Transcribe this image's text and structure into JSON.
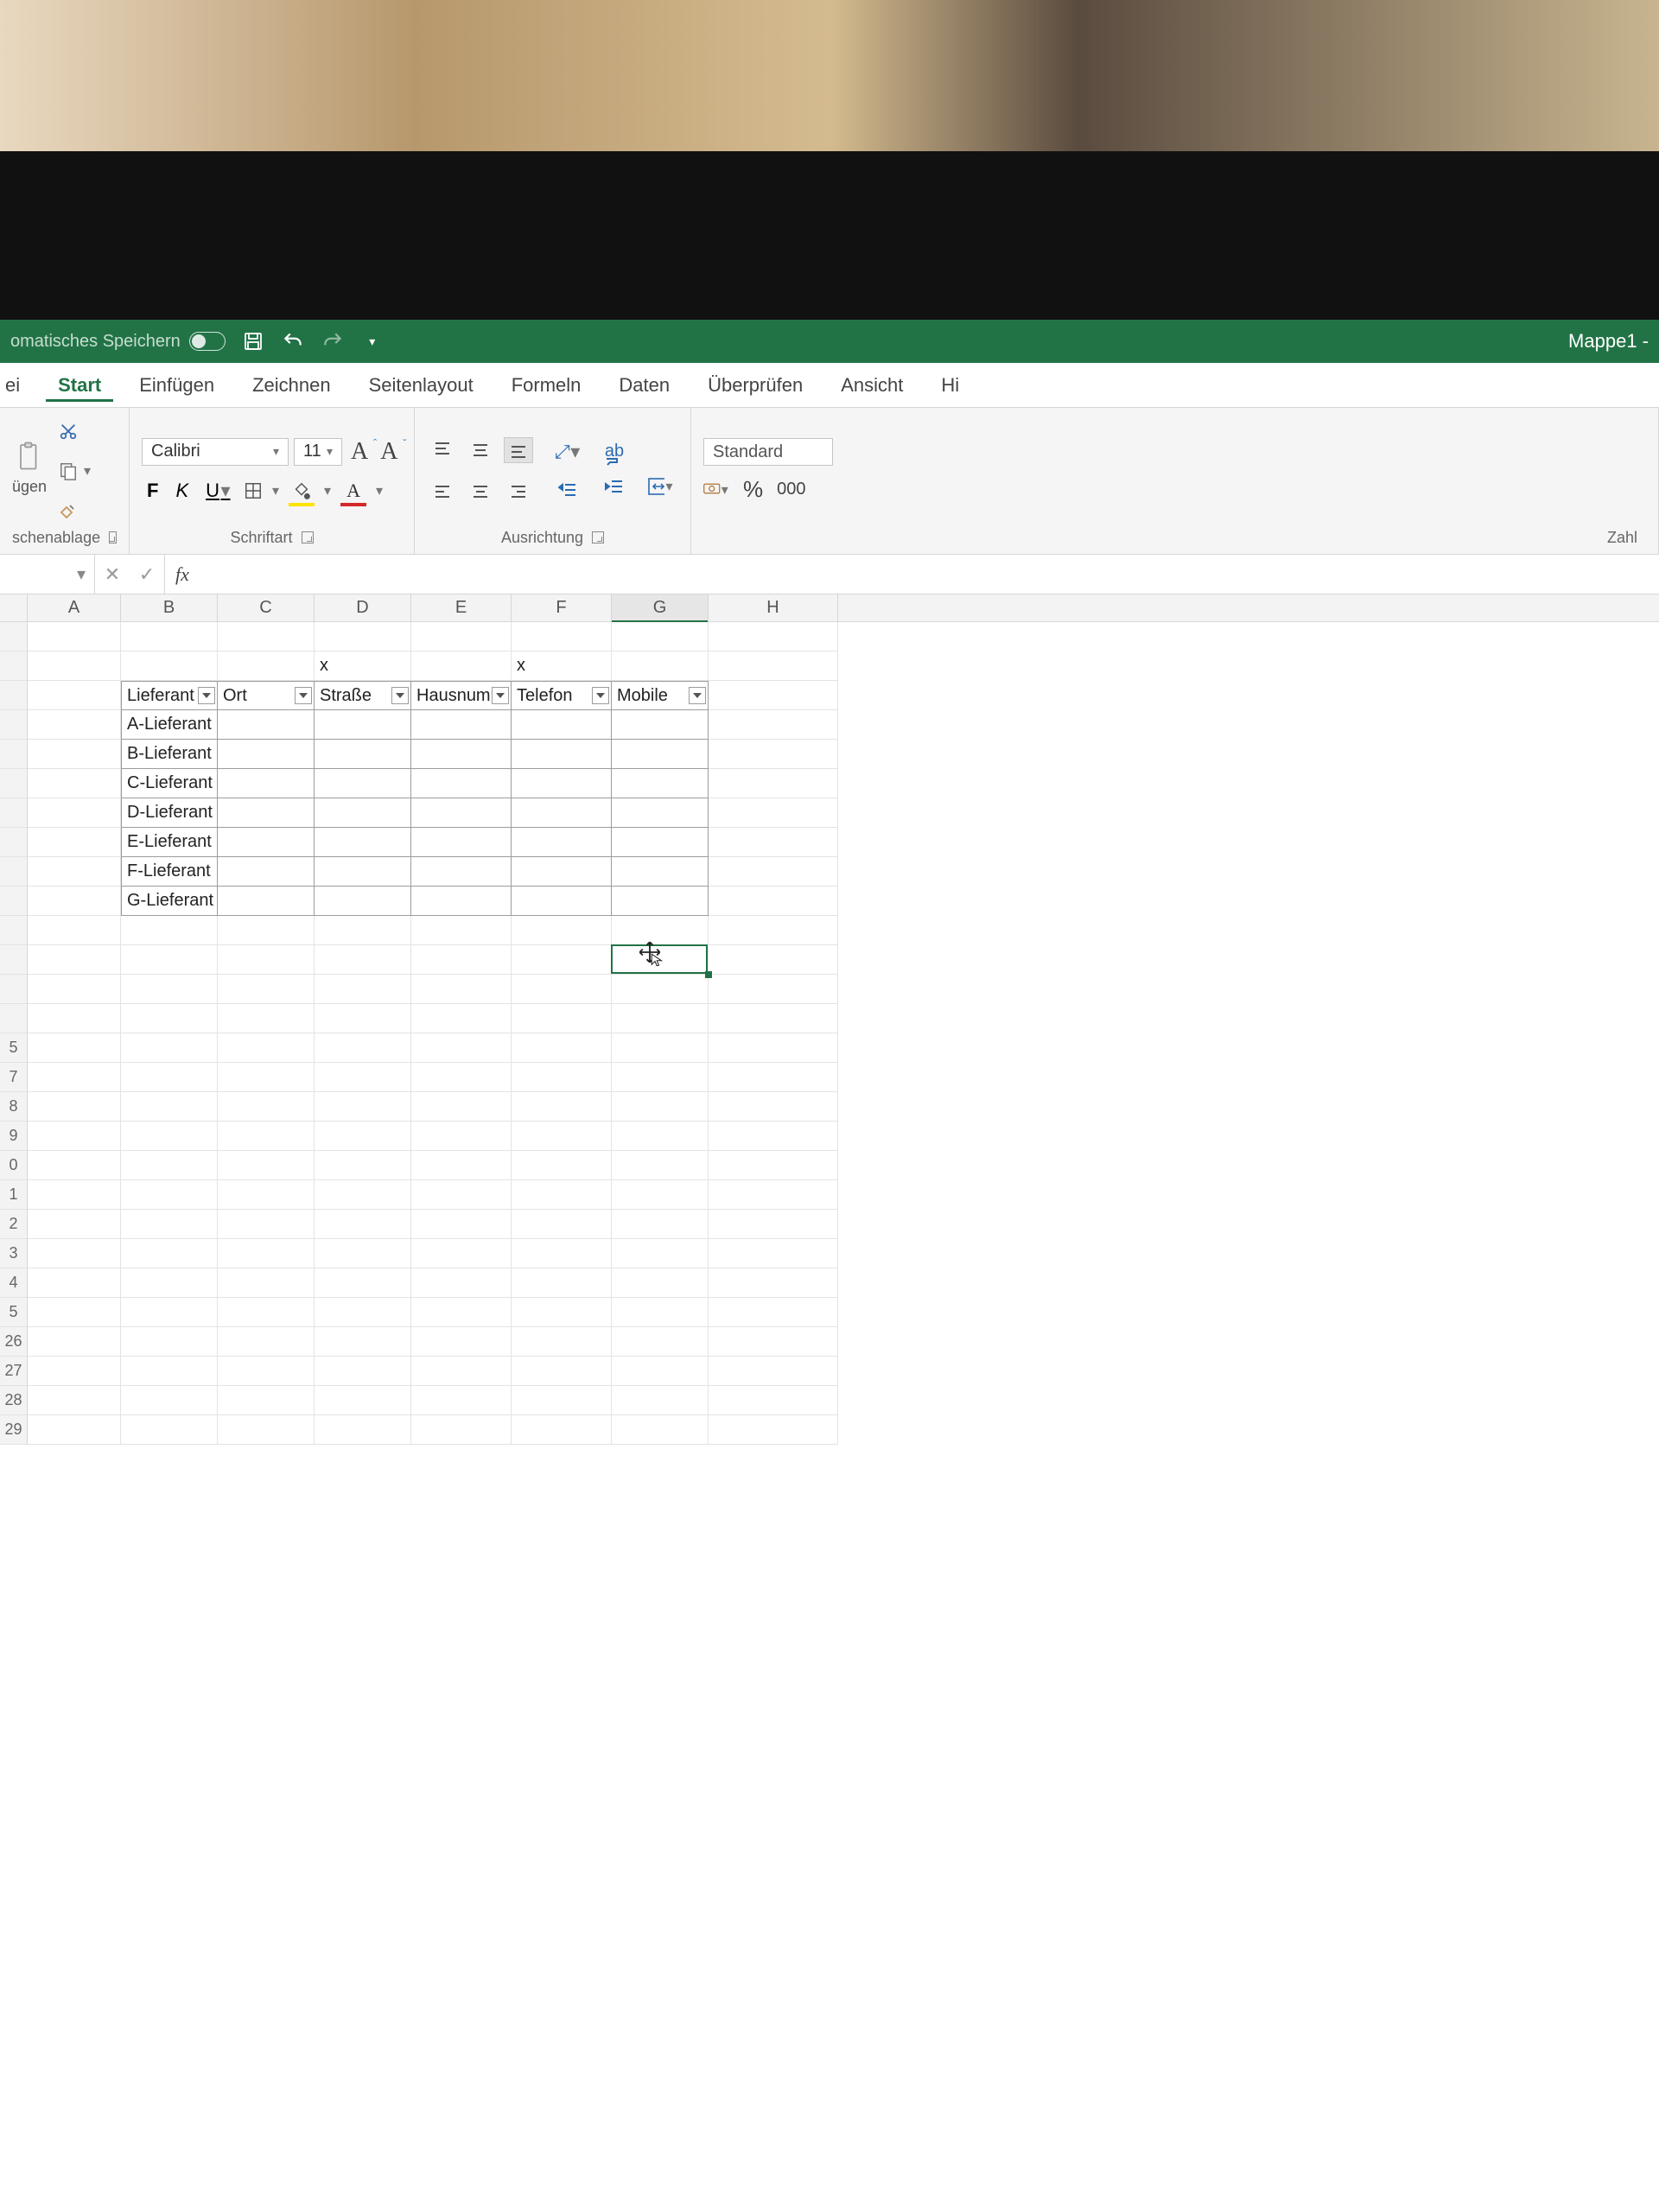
{
  "titlebar": {
    "autosave_label": "omatisches Speichern",
    "doc_title": "Mappe1  -"
  },
  "tabs": {
    "file_cut": "ei",
    "start": "Start",
    "insert": "Einfügen",
    "draw": "Zeichnen",
    "layout": "Seitenlayout",
    "formulas": "Formeln",
    "data": "Daten",
    "review": "Überprüfen",
    "view": "Ansicht",
    "help_cut": "Hi"
  },
  "ribbon": {
    "clipboard": {
      "paste_cut": "ügen",
      "group": "schenablage"
    },
    "font": {
      "name": "Calibri",
      "size": "11",
      "group": "Schriftart",
      "bold": "F",
      "italic": "K",
      "underline": "U",
      "bigA": "A"
    },
    "align": {
      "group": "Ausrichtung",
      "wrap": "ab"
    },
    "number": {
      "format": "Standard",
      "group": "Zahl",
      "pct": "%",
      "thousand": "000"
    }
  },
  "formula_bar": {
    "fx": "fx"
  },
  "columns": [
    {
      "label": "A",
      "w": 108
    },
    {
      "label": "B",
      "w": 112
    },
    {
      "label": "C",
      "w": 112
    },
    {
      "label": "D",
      "w": 112
    },
    {
      "label": "E",
      "w": 116
    },
    {
      "label": "F",
      "w": 116
    },
    {
      "label": "G",
      "w": 112
    },
    {
      "label": "H",
      "w": 150
    }
  ],
  "marks": {
    "D": "x",
    "F": "x"
  },
  "table_headers": [
    {
      "col": "B",
      "label": "Lieferant"
    },
    {
      "col": "C",
      "label": "Ort"
    },
    {
      "col": "D",
      "label": "Straße"
    },
    {
      "col": "E",
      "label": "Hausnumm"
    },
    {
      "col": "F",
      "label": "Telefon"
    },
    {
      "col": "G",
      "label": "Mobile"
    }
  ],
  "table_rows": [
    "A-Lieferant",
    "B-Lieferant",
    "C-Lieferant",
    "D-Lieferant",
    "E-Lieferant",
    "F-Lieferant",
    "G-Lieferant"
  ],
  "visible_row_numbers": [
    "5",
    "7",
    "8",
    "9",
    "0",
    "1",
    "2",
    "3",
    "4",
    "5",
    "26",
    "27",
    "28",
    "29"
  ],
  "selected_cell": {
    "col": "G",
    "row_index_in_view": 11
  }
}
